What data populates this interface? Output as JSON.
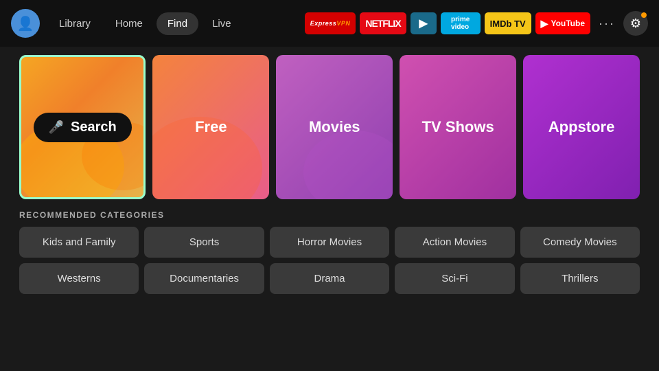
{
  "nav": {
    "avatar_icon": "👤",
    "links": [
      {
        "label": "Library",
        "active": false
      },
      {
        "label": "Home",
        "active": false
      },
      {
        "label": "Find",
        "active": true
      },
      {
        "label": "Live",
        "active": false
      }
    ],
    "apps": [
      {
        "id": "expressvpn",
        "label": "ExpressVPN",
        "class": "app-expressvpn"
      },
      {
        "id": "netflix",
        "label": "NETFLIX",
        "class": "app-netflix"
      },
      {
        "id": "freevee",
        "label": "▶",
        "class": "app-freevee"
      },
      {
        "id": "prime",
        "label": "prime video",
        "class": "app-prime"
      },
      {
        "id": "imdb",
        "label": "IMDb TV",
        "class": "app-imdb"
      },
      {
        "id": "youtube",
        "label": "▶ YouTube",
        "class": "app-youtube"
      }
    ],
    "more_label": "···",
    "settings_icon": "⚙"
  },
  "tiles": [
    {
      "id": "search",
      "label": "Search",
      "mic": "🎤"
    },
    {
      "id": "free",
      "label": "Free"
    },
    {
      "id": "movies",
      "label": "Movies"
    },
    {
      "id": "tvshows",
      "label": "TV Shows"
    },
    {
      "id": "appstore",
      "label": "Appstore"
    }
  ],
  "recommended": {
    "section_title": "RECOMMENDED CATEGORIES",
    "row1": [
      {
        "label": "Kids and Family"
      },
      {
        "label": "Sports"
      },
      {
        "label": "Horror Movies"
      },
      {
        "label": "Action Movies"
      },
      {
        "label": "Comedy Movies"
      }
    ],
    "row2": [
      {
        "label": "Westerns"
      },
      {
        "label": "Documentaries"
      },
      {
        "label": "Drama"
      },
      {
        "label": "Sci-Fi"
      },
      {
        "label": "Thrillers"
      }
    ]
  }
}
